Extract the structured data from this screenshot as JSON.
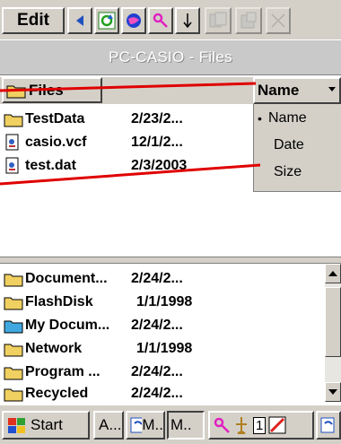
{
  "toolbar": {
    "edit_label": "Edit",
    "icons": [
      "left-arrow-icon",
      "sync-icon",
      "globe-icon",
      "key-icon",
      "down-arrow-icon",
      "copy-icon",
      "paste-icon",
      "delete-icon"
    ]
  },
  "title": "PC-CASIO - Files",
  "header": {
    "files_label": "Files",
    "sort_label": "Name"
  },
  "sort_menu": {
    "options": [
      {
        "label": "Name",
        "selected": true
      },
      {
        "label": "Date",
        "selected": false
      },
      {
        "label": "Size",
        "selected": false
      }
    ],
    "bullet": "•"
  },
  "files": [
    {
      "name": "TestData",
      "date": "2/23/2...",
      "icon": "folder-icon"
    },
    {
      "name": "casio.vcf",
      "date": "12/1/2...",
      "icon": "document-icon"
    },
    {
      "name": "test.dat",
      "date": "2/3/2003",
      "icon": "document-icon"
    }
  ],
  "folders": [
    {
      "name": "Document...",
      "date": "2/24/2..."
    },
    {
      "name": "FlashDisk",
      "date": "1/1/1998"
    },
    {
      "name": "My Docum...",
      "date": "2/24/2..."
    },
    {
      "name": "Network",
      "date": "1/1/1998"
    },
    {
      "name": "Program ...",
      "date": "2/24/2..."
    },
    {
      "name": "Recycled",
      "date": "2/24/2..."
    }
  ],
  "taskbar": {
    "start_label": "Start",
    "task_a": "A...",
    "task_m": "M..",
    "tray_number": "1"
  },
  "colors": {
    "chrome": "#d4d0c8",
    "title_bg": "#c9c9c9",
    "folder": "#f0d060",
    "annotation": "#e00000"
  }
}
